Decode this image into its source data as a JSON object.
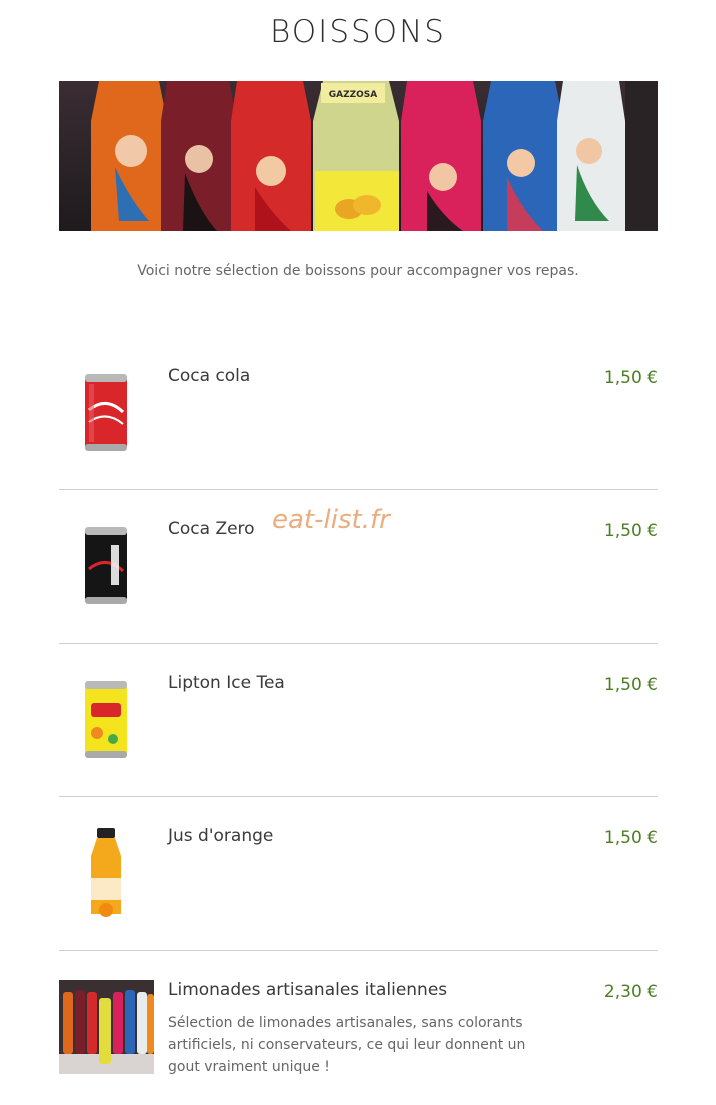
{
  "page": {
    "title": "BOISSONS",
    "intro": "Voici notre sélection de boissons pour accompagner vos repas.",
    "watermark": "eat-list.fr"
  },
  "hero": {
    "image": "italian-soda-bottles-photo",
    "bottle_labels": [
      "GAZZOSA"
    ]
  },
  "items": [
    {
      "name": "Coca cola",
      "price": "1,50 €",
      "image": "coca-cola-can"
    },
    {
      "name": "Coca Zero",
      "price": "1,50 €",
      "image": "coca-zero-can"
    },
    {
      "name": "Lipton Ice Tea",
      "price": "1,50 €",
      "image": "lipton-ice-tea-can"
    },
    {
      "name": "Jus d'orange",
      "price": "1,50 €",
      "image": "orange-juice-bottle"
    },
    {
      "name": "Limonades artisanales italiennes",
      "price": "2,30 €",
      "image": "italian-lemonades-photo",
      "description": "Sélection de limonades artisanales, sans colorants artificiels, ni conservateurs, ce qui leur donnent un gout vraiment unique !"
    }
  ],
  "colors": {
    "price": "#4b7f22",
    "watermark": "#eba46f",
    "divider": "#cfcfcf"
  }
}
